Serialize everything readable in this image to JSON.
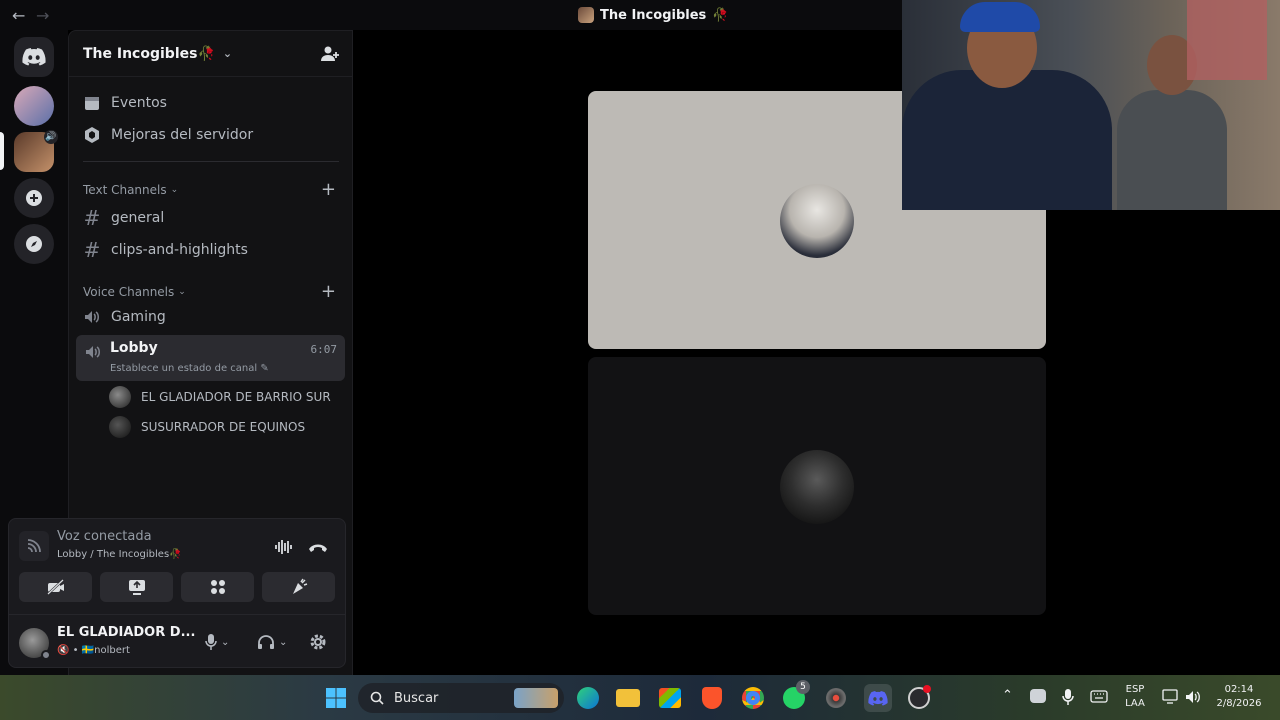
{
  "titlebar": {
    "title": "The Incogibles",
    "title_emoji": "🥀"
  },
  "server": {
    "name": "The Incogibles",
    "name_emoji": "🥀",
    "links": [
      {
        "label": "Eventos"
      },
      {
        "label": "Mejoras del servidor"
      }
    ],
    "text_category": "Text Channels",
    "text_channels": [
      "general",
      "clips-and-highlights"
    ],
    "voice_category": "Voice Channels",
    "voice_channels": [
      "Gaming"
    ],
    "active_voice": {
      "name": "Lobby",
      "status": "Establece un estado de canal",
      "timer": "6:07",
      "members": [
        "EL GLADIADOR DE BARRIO SUR",
        "SUSURRADOR DE EQUINOS"
      ]
    }
  },
  "voice_panel": {
    "title": "Voz conectada",
    "subtitle": "Lobby / The Incogibles",
    "subtitle_emoji": "🥀"
  },
  "user": {
    "name": "EL GLADIADOR D...",
    "sub": "nolbert",
    "flag": "🇸🇪"
  },
  "taskbar": {
    "search_placeholder": "Buscar",
    "whatsapp_badge": "5",
    "lang_top": "ESP",
    "lang_bottom": "LAA",
    "time": "02:14",
    "date": "2/8/2026"
  },
  "colors": {
    "accent": "#5865f2",
    "bg": "#000000",
    "sidebar": "#121214",
    "tile_light": "#bdbab5",
    "tile_dark": "#121214"
  }
}
